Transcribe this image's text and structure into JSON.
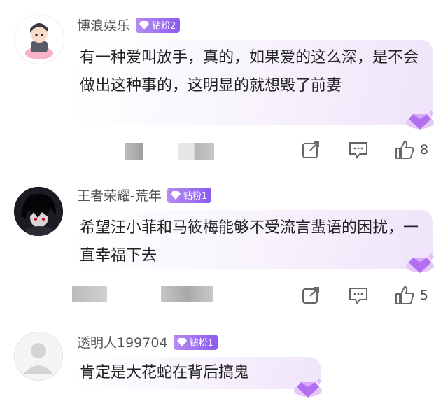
{
  "comments": [
    {
      "username": "博浪娱乐",
      "badge": "钻粉2",
      "text": "有一种爱叫放手，真的，如果爱的这么深，是不会做出这种事的，这明显的就想毁了前妻",
      "likes": "8"
    },
    {
      "username": "王者荣耀-荒年",
      "badge": "钻粉1",
      "text": "希望汪小菲和马筱梅能够不受流言蜚语的困扰，一直幸福下去",
      "likes": "5"
    },
    {
      "username": "透明人199704",
      "badge": "钻粉1",
      "text": "肯定是大花蛇在背后搞鬼"
    }
  ],
  "icons": {
    "badge": "diamond-icon",
    "share": "share-icon",
    "reply": "comment-icon",
    "like": "thumbs-up-icon"
  },
  "colors": {
    "badge": "#9b6cf0",
    "bubble": "#f3ebfb"
  }
}
